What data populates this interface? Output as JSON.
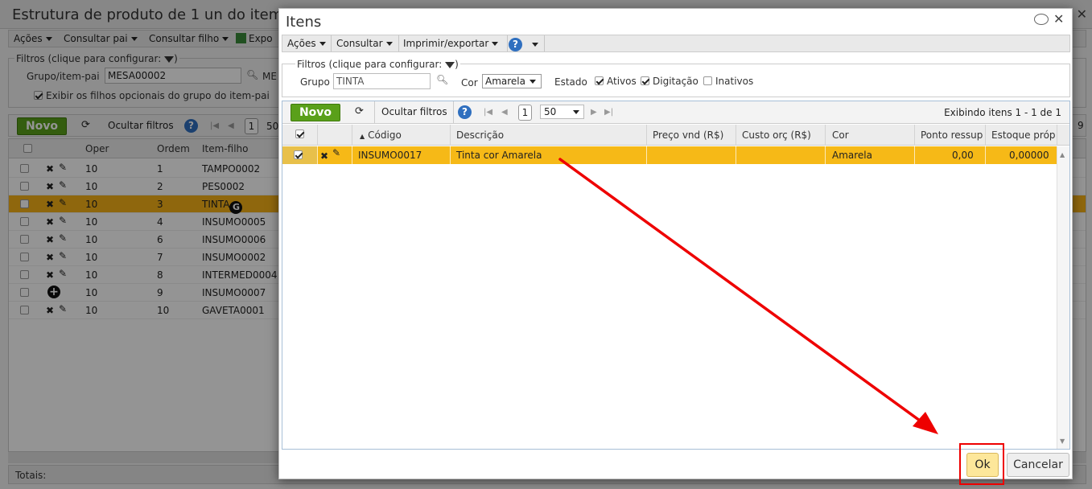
{
  "background": {
    "title": "Estrutura de produto de 1 un do item",
    "toolbar": {
      "acoes": "Ações",
      "consultar_pai": "Consultar pai",
      "consultar_filho": "Consultar filho",
      "export": "Expo"
    },
    "filters": {
      "legend": "Filtros (clique para configurar:",
      "legend_end": ")",
      "grupo_label": "Grupo/item-pai",
      "grupo_value": "MESA00002",
      "me_label": "ME",
      "chk_label": "Exibir os filhos opcionais do grupo do item-pai"
    },
    "grid_toolbar": {
      "novo": "Novo",
      "ocultar": "Ocultar filtros",
      "help": "?",
      "page": "1",
      "pagesize": "50",
      "right_num": "9"
    },
    "columns": [
      "Oper",
      "Ordem",
      "Item-filho"
    ],
    "rows": [
      {
        "oper": "10",
        "ordem": "1",
        "item": "TAMPO0002"
      },
      {
        "oper": "10",
        "ordem": "2",
        "item": "PES0002"
      },
      {
        "oper": "10",
        "ordem": "3",
        "item": "TINTA"
      },
      {
        "oper": "10",
        "ordem": "4",
        "item": "INSUMO0005"
      },
      {
        "oper": "10",
        "ordem": "6",
        "item": "INSUMO0006"
      },
      {
        "oper": "10",
        "ordem": "7",
        "item": "INSUMO0002"
      },
      {
        "oper": "10",
        "ordem": "8",
        "item": "INTERMED0004"
      },
      {
        "oper": "10",
        "ordem": "9",
        "item": "INSUMO0007"
      },
      {
        "oper": "10",
        "ordem": "10",
        "item": "GAVETA0001"
      }
    ],
    "g_badge": "G",
    "totais": "Totais:"
  },
  "modal": {
    "title": "Itens",
    "toolbar": {
      "acoes": "Ações",
      "consultar": "Consultar",
      "imprimir": "Imprimir/exportar",
      "help": "?"
    },
    "filters": {
      "legend": "Filtros (clique para configurar:",
      "legend_end": ")",
      "grupo_label": "Grupo",
      "grupo_value": "TINTA",
      "cor_label": "Cor",
      "cor_value": "Amarela",
      "estado_label": "Estado",
      "ativos": "Ativos",
      "digitacao": "Digitação",
      "inativos": "Inativos"
    },
    "grid_toolbar": {
      "novo": "Novo",
      "ocultar": "Ocultar filtros",
      "help": "?",
      "page": "1",
      "pagesize": "50",
      "exibindo": "Exibindo itens 1 - 1 de 1"
    },
    "columns": {
      "codigo": "Código",
      "descricao": "Descrição",
      "preco": "Preço vnd (R$)",
      "custo": "Custo orç (R$)",
      "cor": "Cor",
      "ponto": "Ponto ressup",
      "estoque": "Estoque próp"
    },
    "row": {
      "codigo": "INSUMO0017",
      "descricao": "Tinta cor Amarela",
      "preco": "",
      "custo": "",
      "cor": "Amarela",
      "ponto": "0,00",
      "estoque": "0,00000"
    },
    "buttons": {
      "ok": "Ok",
      "cancelar": "Cancelar"
    }
  },
  "colors": {
    "selected_row": "#f6b917",
    "novo_green": "#5aa01a",
    "highlight_red": "#e00000"
  }
}
